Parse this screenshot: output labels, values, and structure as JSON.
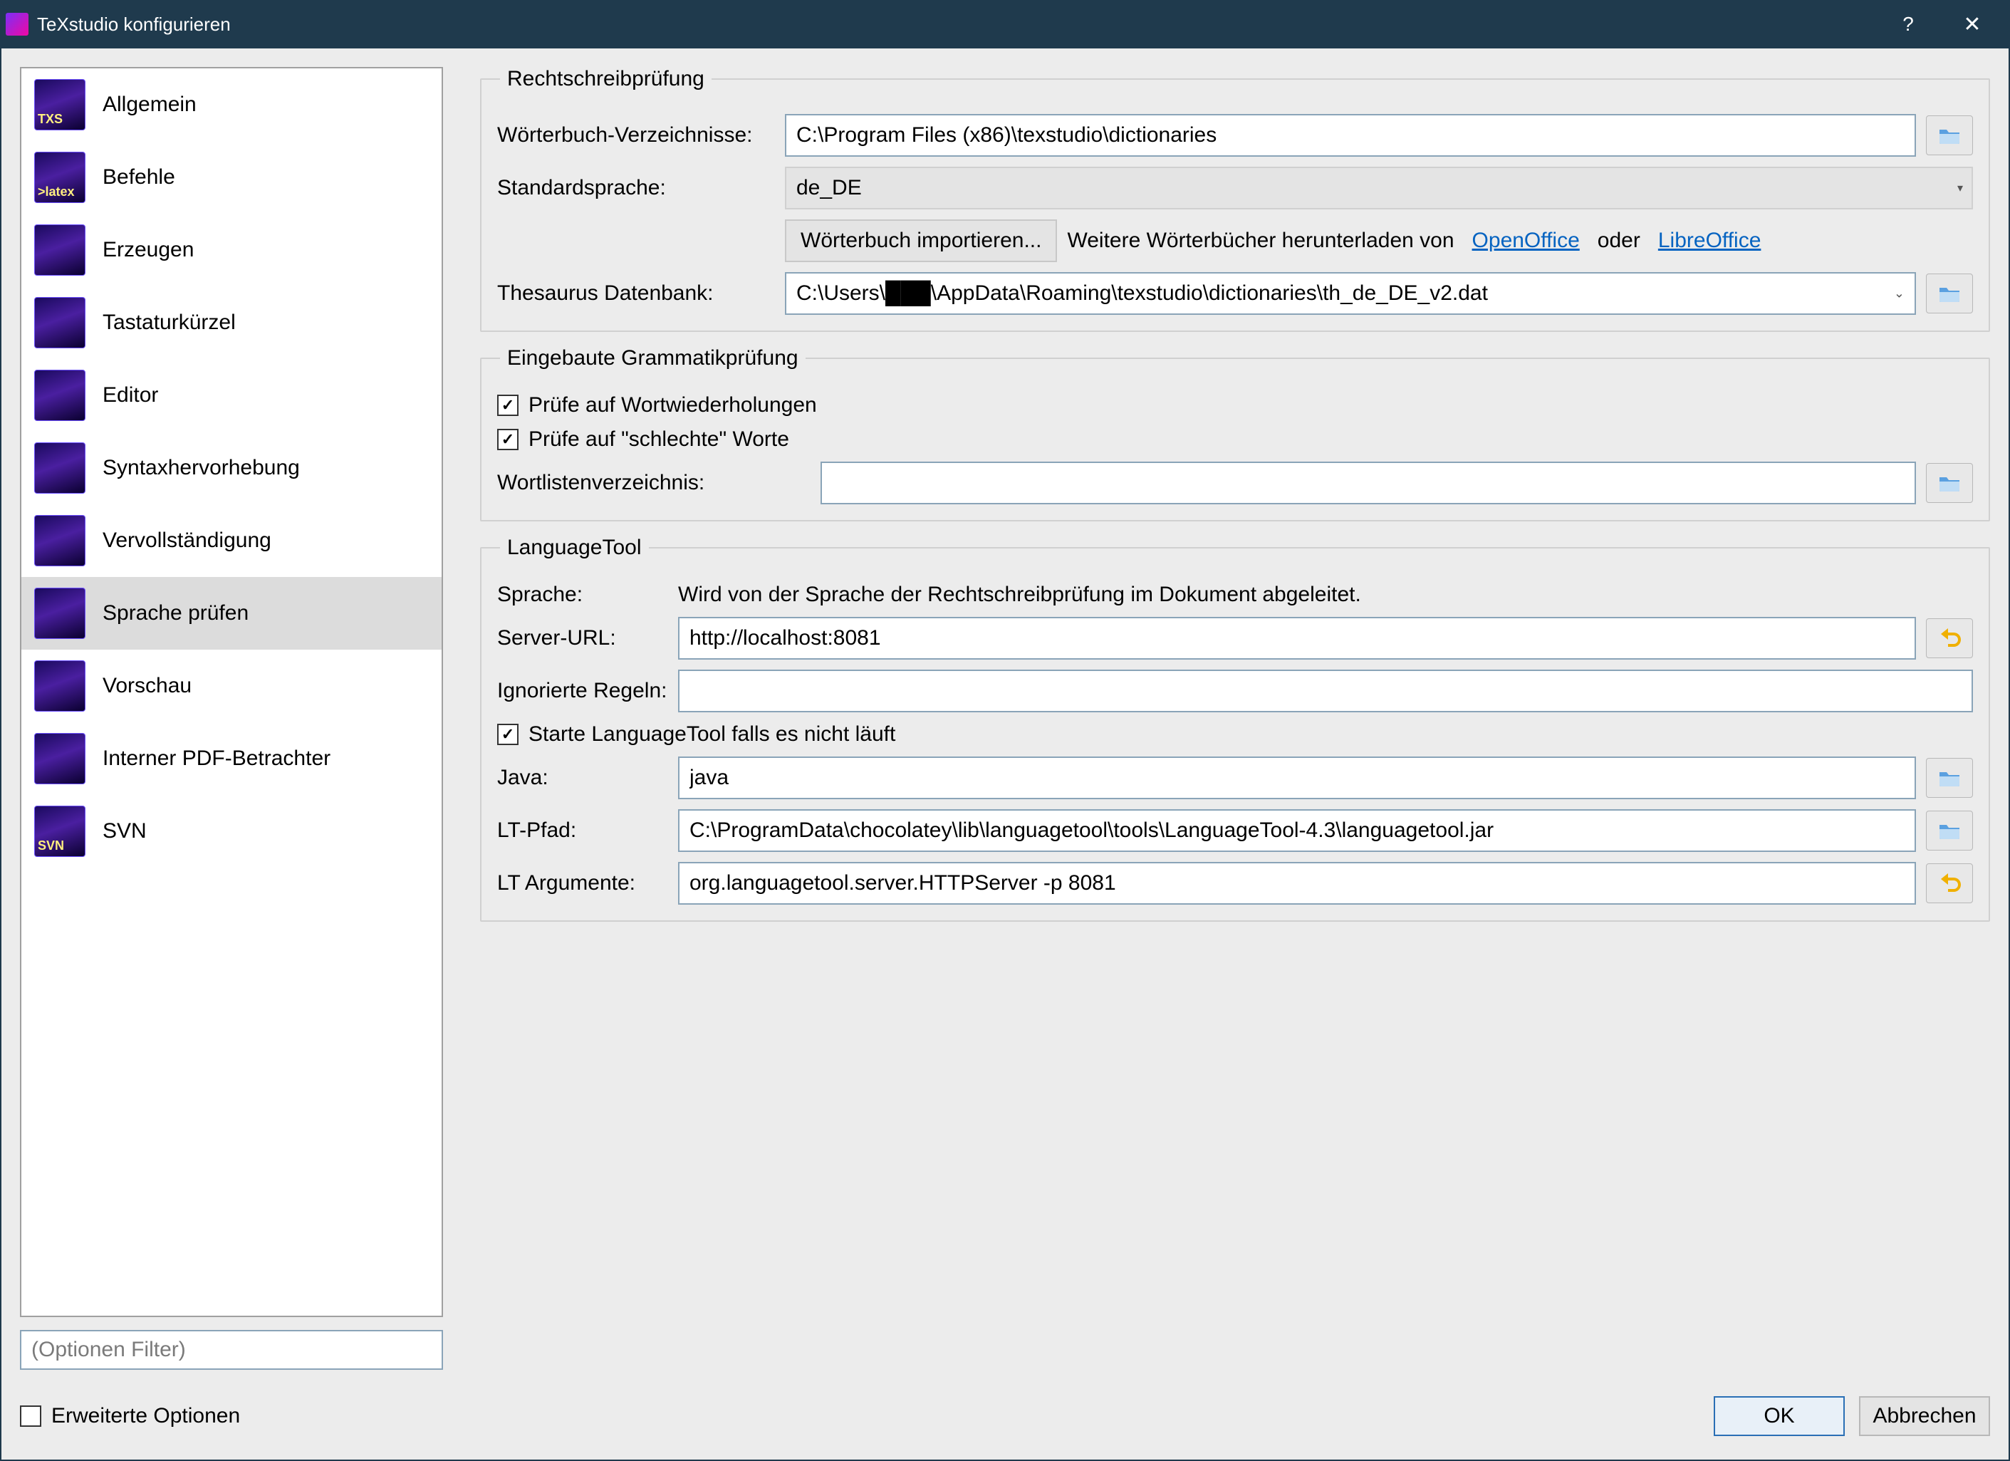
{
  "window": {
    "title": "TeXstudio konfigurieren"
  },
  "sidebar": {
    "items": [
      {
        "label": "Allgemein",
        "iconTxt": "TXS"
      },
      {
        "label": "Befehle",
        "iconTxt": ">latex"
      },
      {
        "label": "Erzeugen",
        "iconTxt": ""
      },
      {
        "label": "Tastaturkürzel",
        "iconTxt": ""
      },
      {
        "label": "Editor",
        "iconTxt": ""
      },
      {
        "label": "Syntaxhervorhebung",
        "iconTxt": ""
      },
      {
        "label": "Vervollständigung",
        "iconTxt": ""
      },
      {
        "label": "Sprache prüfen",
        "iconTxt": "",
        "selected": true
      },
      {
        "label": "Vorschau",
        "iconTxt": ""
      },
      {
        "label": "Interner PDF-Betrachter",
        "iconTxt": ""
      },
      {
        "label": "SVN",
        "iconTxt": "SVN"
      }
    ],
    "filterPlaceholder": "(Optionen Filter)"
  },
  "spell": {
    "legend": "Rechtschreibprüfung",
    "dictDirsLabel": "Wörterbuch-Verzeichnisse:",
    "dictDirsValue": "C:\\Program Files (x86)\\texstudio\\dictionaries",
    "defaultLangLabel": "Standardsprache:",
    "defaultLangValue": "de_DE",
    "importBtn": "Wörterbuch importieren...",
    "downloadPrefix": "Weitere Wörterbücher herunterladen von",
    "openOffice": "OpenOffice",
    "oder": "oder",
    "libreOffice": "LibreOffice",
    "thesaurusLabel": "Thesaurus Datenbank:",
    "thesaurusValue": "C:\\Users\\███\\AppData\\Roaming\\texstudio\\dictionaries\\th_de_DE_v2.dat"
  },
  "grammar": {
    "legend": "Eingebaute Grammatikprüfung",
    "repetitionLabel": "Prüfe auf Wortwiederholungen",
    "repetitionChecked": true,
    "badWordsLabel": "Prüfe auf \"schlechte\" Worte",
    "badWordsChecked": true,
    "wordlistLabel": "Wortlistenverzeichnis:",
    "wordlistValue": ""
  },
  "lt": {
    "legend": "LanguageTool",
    "langLabel": "Sprache:",
    "langValue": "Wird von der Sprache der Rechtschreibprüfung im Dokument abgeleitet.",
    "serverLabel": "Server-URL:",
    "serverValue": "http://localhost:8081",
    "ignoredLabel": "Ignorierte Regeln:",
    "ignoredValue": "",
    "startLabel": "Starte LanguageTool falls es nicht läuft",
    "startChecked": true,
    "javaLabel": "Java:",
    "javaValue": "java",
    "ltPathLabel": "LT-Pfad:",
    "ltPathValue": "C:\\ProgramData\\chocolatey\\lib\\languagetool\\tools\\LanguageTool-4.3\\languagetool.jar",
    "ltArgsLabel": "LT Argumente:",
    "ltArgsValue": "org.languagetool.server.HTTPServer -p 8081"
  },
  "bottom": {
    "advanced": "Erweiterte Optionen",
    "advancedChecked": false,
    "ok": "OK",
    "cancel": "Abbrechen"
  }
}
